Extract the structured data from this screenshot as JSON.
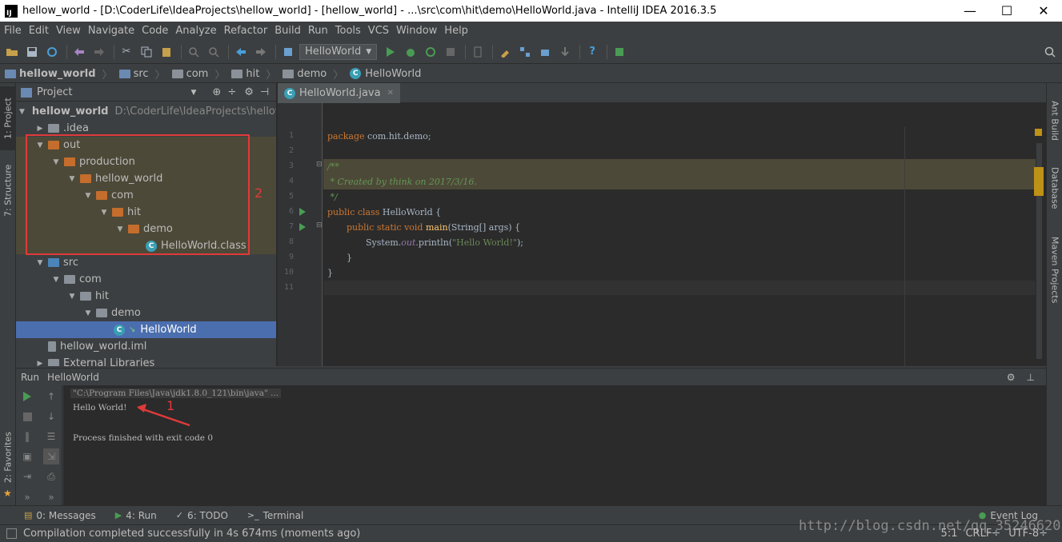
{
  "window": {
    "title": "hellow_world - [D:\\CoderLife\\IdeaProjects\\hellow_world] - [hellow_world] - ...\\src\\com\\hit\\demo\\HelloWorld.java - IntelliJ IDEA 2016.3.5",
    "logo": "IJ",
    "minimize": "—",
    "maximize": "☐",
    "close": "✕"
  },
  "menu": [
    "File",
    "Edit",
    "View",
    "Navigate",
    "Code",
    "Analyze",
    "Refactor",
    "Build",
    "Run",
    "Tools",
    "VCS",
    "Window",
    "Help"
  ],
  "toolbar": {
    "run_config": "HelloWorld"
  },
  "breadcrumb": [
    "hellow_world",
    "src",
    "com",
    "hit",
    "demo",
    "HelloWorld"
  ],
  "left_stripe": {
    "project": "1: Project",
    "structure": "7: Structure",
    "favorites": "2: Favorites"
  },
  "right_stripe": {
    "ant": "Ant Build",
    "database": "Database",
    "maven": "Maven Projects"
  },
  "project_panel": {
    "header": "Project",
    "root": "hellow_world",
    "root_path": "D:\\CoderLife\\IdeaProjects\\hellow_",
    "items": [
      {
        "label": ".idea"
      },
      {
        "label": "out"
      },
      {
        "label": "production"
      },
      {
        "label": "hellow_world"
      },
      {
        "label": "com"
      },
      {
        "label": "hit"
      },
      {
        "label": "demo"
      },
      {
        "label": "HelloWorld.class"
      },
      {
        "label": "src"
      },
      {
        "label": "com"
      },
      {
        "label": "hit"
      },
      {
        "label": "demo"
      },
      {
        "label": "HelloWorld"
      },
      {
        "label": "hellow_world.iml"
      },
      {
        "label": "External Libraries"
      }
    ],
    "annotation": "2"
  },
  "editor": {
    "tab": "HelloWorld.java",
    "line_numbers": [
      "1",
      "2",
      "3",
      "4",
      "5",
      "6",
      "7",
      "8",
      "9",
      "10",
      "11"
    ],
    "code": {
      "l1_kw": "package",
      "l1_rest": " com.hit.demo;",
      "l3": "/**",
      "l4": " * Created by think on 2017/3/16.",
      "l5": " */",
      "l6_kw": "public class",
      "l6_rest": " HelloWorld {",
      "l7_kw": "public static void",
      "l7_fn": "main",
      "l7_rest": "(String[] args) {",
      "l8_a": "System.",
      "l8_fld": "out",
      "l8_b": ".println(",
      "l8_str": "\"Hello World!\"",
      "l8_c": ");",
      "l9": "}",
      "l10": "}"
    }
  },
  "run_panel": {
    "label": "Run",
    "config": "HelloWorld",
    "console": [
      "\"C:\\Program Files\\Java\\jdk1.8.0_121\\bin\\java\" ...",
      "Hello World!",
      "",
      "Process finished with exit code 0"
    ],
    "annotation": "1"
  },
  "bottom_tabs": [
    {
      "icon": "▤",
      "label": "0: Messages"
    },
    {
      "icon": "▶",
      "label": "4: Run"
    },
    {
      "icon": "✓",
      "label": "6: TODO"
    },
    {
      "icon": ">_",
      "label": "Terminal"
    }
  ],
  "event_log": "Event Log",
  "status": {
    "message": "Compilation completed successfully in 4s 674ms (moments ago)",
    "position": "5:1",
    "line_sep": "CRLF÷",
    "encoding": "UTF-8÷"
  },
  "watermark": "http://blog.csdn.net/qq_35246620",
  "colors": {
    "accent_selection": "#4b6eaf",
    "annotation_red": "#e03a3a",
    "run_green": "#499c54"
  }
}
